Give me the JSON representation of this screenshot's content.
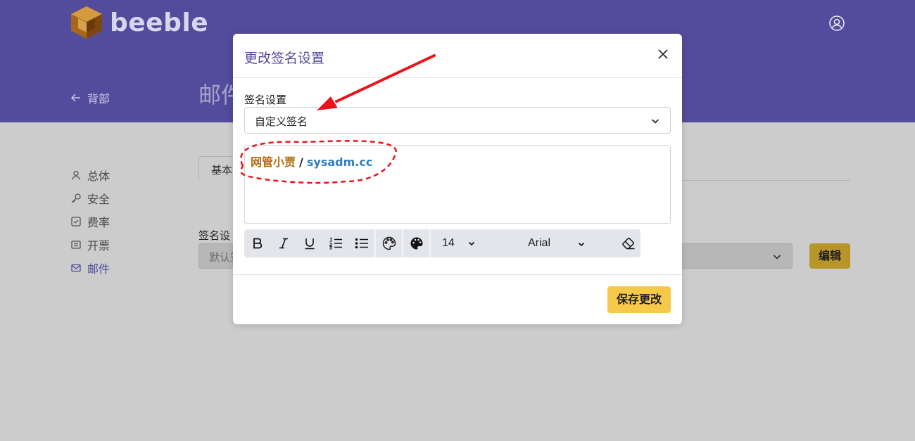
{
  "app": {
    "brand": "beeble",
    "brand_color": "#534b9b",
    "accent": "#f6c94a"
  },
  "header": {
    "back_label": "背部",
    "page_title": "邮件",
    "user_icon": "user-circle-icon"
  },
  "sidebar": {
    "items": [
      {
        "label": "总体",
        "icon": "user-icon"
      },
      {
        "label": "安全",
        "icon": "key-icon"
      },
      {
        "label": "费率",
        "icon": "checkbox-icon"
      },
      {
        "label": "开票",
        "icon": "receipt-icon"
      },
      {
        "label": "邮件",
        "icon": "mail-icon",
        "active": true
      }
    ]
  },
  "background": {
    "tab_basic": "基本",
    "signature_label": "签名设",
    "select_value": "默认签",
    "edit_button": "编辑"
  },
  "modal": {
    "title": "更改签名设置",
    "field_label": "签名设置",
    "select_value": "自定义签名",
    "signature": {
      "name": "网管小贾",
      "separator": "/",
      "domain": "sysadm.cc"
    },
    "toolbar": {
      "bold": "B",
      "italic": "I",
      "underline": "U",
      "font_size": "14",
      "font_family": "Arial"
    },
    "save_button": "保存更改"
  },
  "annotation_color": "#e8141a"
}
